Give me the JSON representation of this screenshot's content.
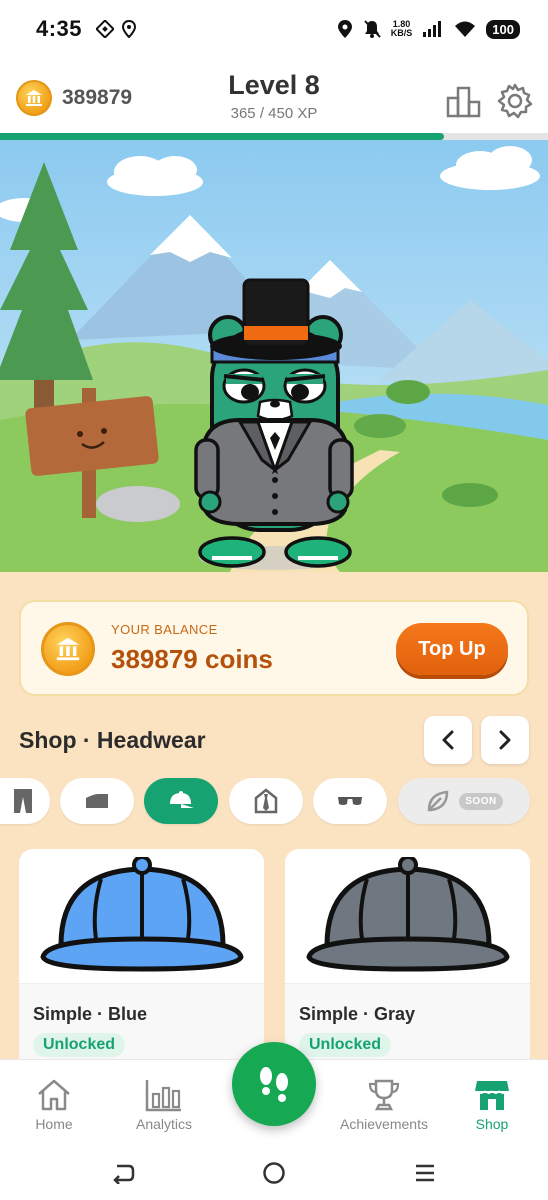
{
  "status_bar": {
    "time": "4:35",
    "net_speed_value": "1.80",
    "net_speed_unit": "KB/S",
    "battery": "100"
  },
  "header": {
    "coins": "389879",
    "level": "Level 8",
    "xp": "365 / 450 XP",
    "xp_progress": 0.81
  },
  "balance": {
    "label": "YOUR BALANCE",
    "value": "389879 coins",
    "top_up_label": "Top Up"
  },
  "shop": {
    "title": "Shop · Headwear",
    "categories": [
      {
        "name": "pants-icon",
        "active": false
      },
      {
        "name": "shoe-icon",
        "active": false
      },
      {
        "name": "cap-icon",
        "active": true
      },
      {
        "name": "tie-icon",
        "active": false
      },
      {
        "name": "sunglasses-icon",
        "active": false
      },
      {
        "name": "leaf-icon",
        "active": false,
        "badge": "SOON"
      }
    ],
    "items": [
      {
        "name": "Simple · Blue",
        "status": "Unlocked",
        "color": "#5da4f5"
      },
      {
        "name": "Simple · Gray",
        "status": "Unlocked",
        "color": "#6f7780"
      }
    ]
  },
  "bottom_nav": {
    "items": [
      {
        "label": "Home",
        "icon": "home-icon"
      },
      {
        "label": "Analytics",
        "icon": "analytics-icon"
      },
      {
        "label": "Achievements",
        "icon": "trophy-icon"
      },
      {
        "label": "Shop",
        "icon": "shop-icon",
        "active": true
      }
    ]
  },
  "colors": {
    "accent": "#17a271",
    "orange": "#f0701a",
    "coin": "#f2a01a"
  }
}
